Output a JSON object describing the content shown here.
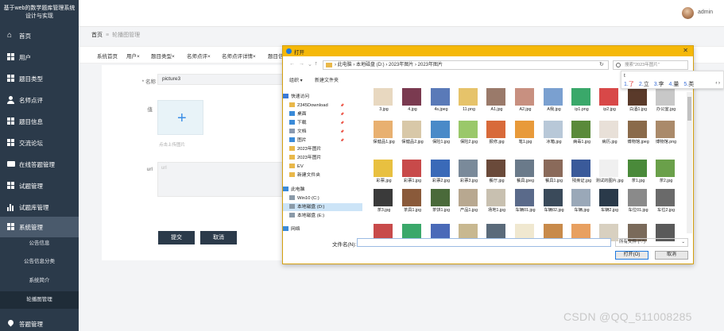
{
  "sidebar": {
    "title": "基于web的数学题库管理系统设计与实现",
    "items": [
      {
        "label": "首页",
        "icon": "home-icon"
      },
      {
        "label": "用户",
        "icon": "grid-icon"
      },
      {
        "label": "题目类型",
        "icon": "grid-icon"
      },
      {
        "label": "名师点评",
        "icon": "user-icon"
      },
      {
        "label": "题目信息",
        "icon": "grid-icon"
      },
      {
        "label": "交流论坛",
        "icon": "grid-icon"
      },
      {
        "label": "在线答题管理",
        "icon": "chat-icon"
      },
      {
        "label": "试题管理",
        "icon": "grid-icon"
      },
      {
        "label": "试题库管理",
        "icon": "bar-chart-icon"
      },
      {
        "label": "系统管理",
        "icon": "grid-icon"
      }
    ],
    "sub_items": [
      "公告信息",
      "公告信息分类",
      "系统简介",
      "轮播图管理"
    ],
    "bottom_item": {
      "label": "答题管理",
      "icon": "pin-icon"
    }
  },
  "header": {
    "username": "admin"
  },
  "breadcrumb": {
    "home": "首页",
    "separator": "≡",
    "current": "轮播图管理"
  },
  "tabs": [
    "系统首页",
    "用户×",
    "题目类型×",
    "名师点评×",
    "名师点评详情×",
    "题目信"
  ],
  "form": {
    "name_label": "* 名称",
    "name_value": "picture3",
    "value_label": "值",
    "upload_hint": "点击上传图片",
    "url_label": "url",
    "url_placeholder": "url",
    "submit": "提交",
    "cancel": "取消"
  },
  "dialog": {
    "title": "打开",
    "path": "› 此电脑 › 本地磁盘 (D:) › 2023年图片 › 2023年图片",
    "search_placeholder": "搜索\"2023年图片\"",
    "organize": "组织 ▾",
    "new_folder": "新建文件夹",
    "tree": [
      {
        "label": "快速访问",
        "icon": "star-icon"
      },
      {
        "label": "2345Download",
        "icon": "folder-icon"
      },
      {
        "label": "桌面",
        "icon": "desktop-icon"
      },
      {
        "label": "下载",
        "icon": "download-icon"
      },
      {
        "label": "文档",
        "icon": "document-icon"
      },
      {
        "label": "图片",
        "icon": "picture-icon"
      },
      {
        "label": "2023年图片",
        "icon": "folder-icon"
      },
      {
        "label": "2023年图片",
        "icon": "folder-icon"
      },
      {
        "label": "EV",
        "icon": "folder-icon"
      },
      {
        "label": "新建文件夹",
        "icon": "folder-icon"
      },
      {
        "label": "此电脑",
        "icon": "computer-icon"
      },
      {
        "label": "Win10 (C:)",
        "icon": "drive-icon"
      },
      {
        "label": "本地磁盘 (D:)",
        "icon": "drive-icon"
      },
      {
        "label": "本地磁盘 (E:)",
        "icon": "drive-icon"
      },
      {
        "label": "网络",
        "icon": "network-icon"
      }
    ],
    "files": [
      {
        "name": "3.jpg",
        "color": "#e8d8c0"
      },
      {
        "name": "4.jpg",
        "color": "#7a3a50"
      },
      {
        "name": "4s.jpeg",
        "color": "#5a7ab8"
      },
      {
        "name": "11.png",
        "color": "#e6c36a"
      },
      {
        "name": "A1.jpg",
        "color": "#9a7a6a"
      },
      {
        "name": "A2.jpg",
        "color": "#c89080"
      },
      {
        "name": "A我.jpg",
        "color": "#7aa0d0"
      },
      {
        "name": "ip1.png",
        "color": "#3aa86a"
      },
      {
        "name": "ip2.jpg",
        "color": "#d84848"
      },
      {
        "name": "白酒1.jpg",
        "color": "#5a3a2a"
      },
      {
        "name": "办公室.jpg",
        "color": "#c8c8c8"
      },
      {
        "name": "保健品1.jpg",
        "color": "#e8b070"
      },
      {
        "name": "保健品2.jpg",
        "color": "#d8c8a8"
      },
      {
        "name": "保险1.jpg",
        "color": "#4a8ac8"
      },
      {
        "name": "保险2.jpg",
        "color": "#9ac86a"
      },
      {
        "name": "报修.jpg",
        "color": "#d86a3a"
      },
      {
        "name": "笔1.jpg",
        "color": "#e89a3a"
      },
      {
        "name": "冰箱.jpg",
        "color": "#b8c8d8"
      },
      {
        "name": "病毒1.jpg",
        "color": "#5a8a3a"
      },
      {
        "name": "病历.jpg",
        "color": "#e8e0d8"
      },
      {
        "name": "博物馆.jpeg",
        "color": "#8a6a4a"
      },
      {
        "name": "博物馆.png",
        "color": "#aa8a6a"
      },
      {
        "name": "彩票.jpg",
        "color": "#e8c040"
      },
      {
        "name": "彩票1.jpg",
        "color": "#c84a4a"
      },
      {
        "name": "彩票2.jpg",
        "color": "#3a6ab8"
      },
      {
        "name": "彩票3.jpg",
        "color": "#7a8a9a"
      },
      {
        "name": "餐厅.jpg",
        "color": "#6a4a3a"
      },
      {
        "name": "餐具.jpeg",
        "color": "#6a7a8a"
      },
      {
        "name": "餐具1.jpg",
        "color": "#8a6a5a"
      },
      {
        "name": "残疾证.jpg",
        "color": "#3a5a9a"
      },
      {
        "name": "测试的图片.jpg",
        "color": "#f0f0f0"
      },
      {
        "name": "茶1.jpg",
        "color": "#4a8a3a"
      },
      {
        "name": "茶2.jpg",
        "color": "#6aa04a"
      },
      {
        "name": "茶3.jpg",
        "color": "#3a3a3a"
      },
      {
        "name": "茶具1.jpg",
        "color": "#8a5a3a"
      },
      {
        "name": "茶饼1.jpg",
        "color": "#4a6a3a"
      },
      {
        "name": "产品1.jpg",
        "color": "#b8a890"
      },
      {
        "name": "场地1.jpg",
        "color": "#c8c0b0"
      },
      {
        "name": "车辆01.jpg",
        "color": "#5a6a8a"
      },
      {
        "name": "车辆02.jpg",
        "color": "#3a4a5a"
      },
      {
        "name": "车辆.jpg",
        "color": "#9aa8b8"
      },
      {
        "name": "车辆2.jpg",
        "color": "#2a3a4a"
      },
      {
        "name": "车位01.jpg",
        "color": "#8a8a8a"
      },
      {
        "name": "车位2.jpg",
        "color": "#6a6a6a"
      },
      {
        "name": "",
        "color": "#c84a4a"
      },
      {
        "name": "",
        "color": "#3aa86a"
      },
      {
        "name": "",
        "color": "#4a6ab8"
      },
      {
        "name": "",
        "color": "#c8b890"
      },
      {
        "name": "",
        "color": "#5a6a7a"
      },
      {
        "name": "",
        "color": "#f0e8d0"
      },
      {
        "name": "",
        "color": "#c88a4a"
      },
      {
        "name": "",
        "color": "#e8a060"
      },
      {
        "name": "",
        "color": "#d8d0c0"
      },
      {
        "name": "",
        "color": "#7a6a5a"
      },
      {
        "name": "",
        "color": "#5a5a5a"
      }
    ],
    "filename_label": "文件名(N):",
    "filetype": "所有文件 (*.*)",
    "open": "打开(O)",
    "cancel": "取消"
  },
  "ime": {
    "input": "t",
    "candidates": [
      {
        "n": "1.",
        "w": "了"
      },
      {
        "n": "2.",
        "w": "立"
      },
      {
        "n": "3.",
        "w": "李"
      },
      {
        "n": "4.",
        "w": "量"
      },
      {
        "n": "5.",
        "w": "类"
      }
    ],
    "nav": "‹ ›"
  },
  "watermark": "CSDN @QQ_511008285"
}
